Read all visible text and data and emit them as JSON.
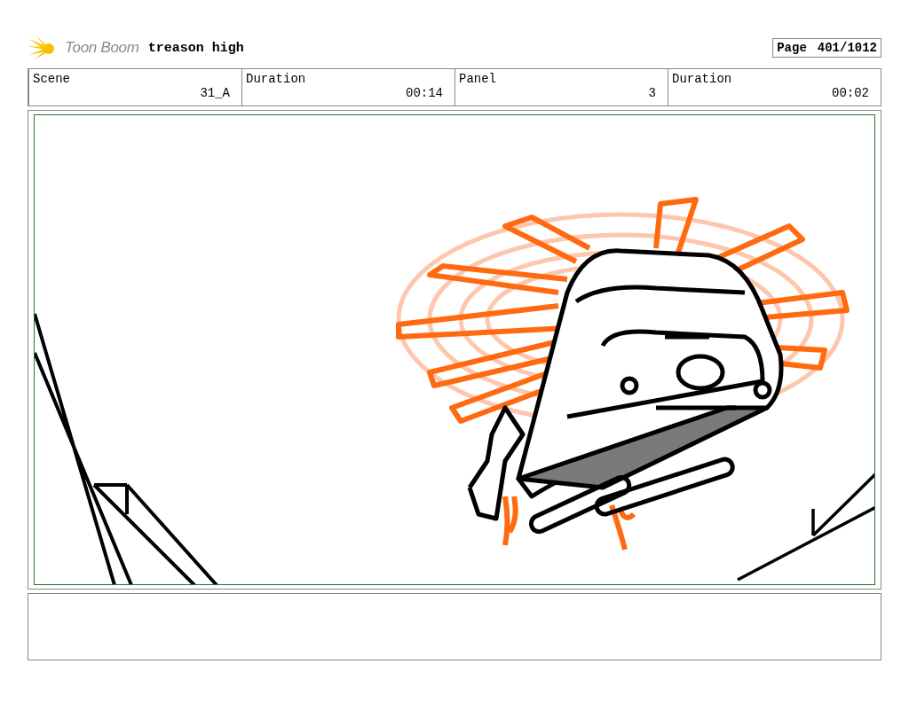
{
  "header": {
    "logo": "Toon Boom",
    "title": "treason high",
    "page_label": "Page",
    "page_number": "401/1012"
  },
  "info": [
    {
      "label": "Scene",
      "value": "31_A"
    },
    {
      "label": "Duration",
      "value": "00:14"
    },
    {
      "label": "Panel",
      "value": "3"
    },
    {
      "label": "Duration",
      "value": "00:02"
    }
  ]
}
